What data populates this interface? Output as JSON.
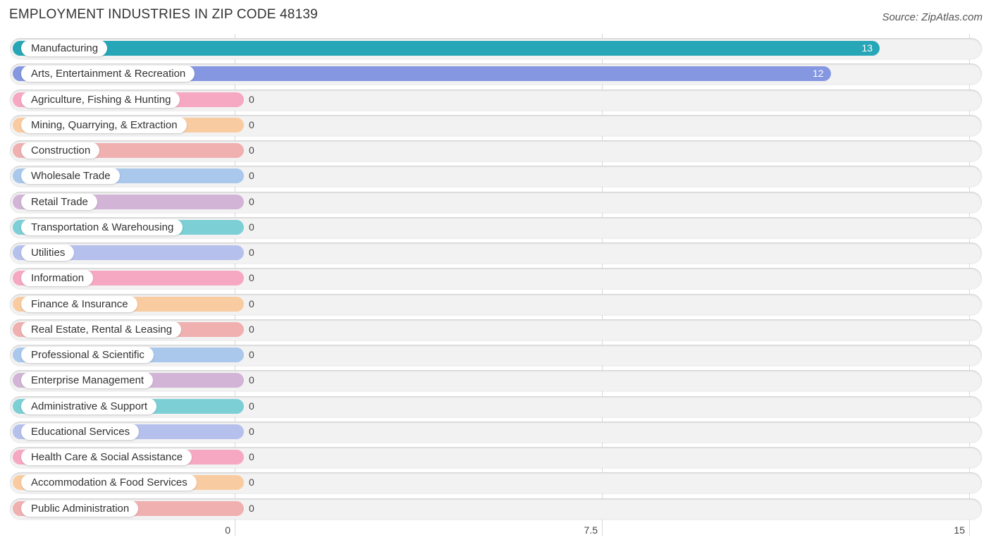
{
  "chart_data": {
    "type": "bar",
    "orientation": "horizontal",
    "title": "EMPLOYMENT INDUSTRIES IN ZIP CODE 48139",
    "source": "Source: ZipAtlas.com",
    "xlabel": "",
    "ylabel": "",
    "xlim": [
      0,
      15
    ],
    "xticks": [
      {
        "value": 0,
        "label": "0"
      },
      {
        "value": 7.5,
        "label": "7.5"
      },
      {
        "value": 15,
        "label": "15"
      }
    ],
    "grid": true,
    "categories": [
      {
        "label": "Manufacturing",
        "value": 13,
        "color": "#26a6b6"
      },
      {
        "label": "Arts, Entertainment & Recreation",
        "value": 12,
        "color": "#8597e0"
      },
      {
        "label": "Agriculture, Fishing & Hunting",
        "value": 0,
        "color": "#f6a8c2"
      },
      {
        "label": "Mining, Quarrying, & Extraction",
        "value": 0,
        "color": "#f9cba0"
      },
      {
        "label": "Construction",
        "value": 0,
        "color": "#f0b0b0"
      },
      {
        "label": "Wholesale Trade",
        "value": 0,
        "color": "#a9c8ec"
      },
      {
        "label": "Retail Trade",
        "value": 0,
        "color": "#d2b5d6"
      },
      {
        "label": "Transportation & Warehousing",
        "value": 0,
        "color": "#7ccfd5"
      },
      {
        "label": "Utilities",
        "value": 0,
        "color": "#b5c0ec"
      },
      {
        "label": "Information",
        "value": 0,
        "color": "#f6a8c2"
      },
      {
        "label": "Finance & Insurance",
        "value": 0,
        "color": "#f9cba0"
      },
      {
        "label": "Real Estate, Rental & Leasing",
        "value": 0,
        "color": "#f0b0b0"
      },
      {
        "label": "Professional & Scientific",
        "value": 0,
        "color": "#a9c8ec"
      },
      {
        "label": "Enterprise Management",
        "value": 0,
        "color": "#d2b5d6"
      },
      {
        "label": "Administrative & Support",
        "value": 0,
        "color": "#7ccfd5"
      },
      {
        "label": "Educational Services",
        "value": 0,
        "color": "#b5c0ec"
      },
      {
        "label": "Health Care & Social Assistance",
        "value": 0,
        "color": "#f6a8c2"
      },
      {
        "label": "Accommodation & Food Services",
        "value": 0,
        "color": "#f9cba0"
      },
      {
        "label": "Public Administration",
        "value": 0,
        "color": "#f0b0b0"
      }
    ]
  }
}
